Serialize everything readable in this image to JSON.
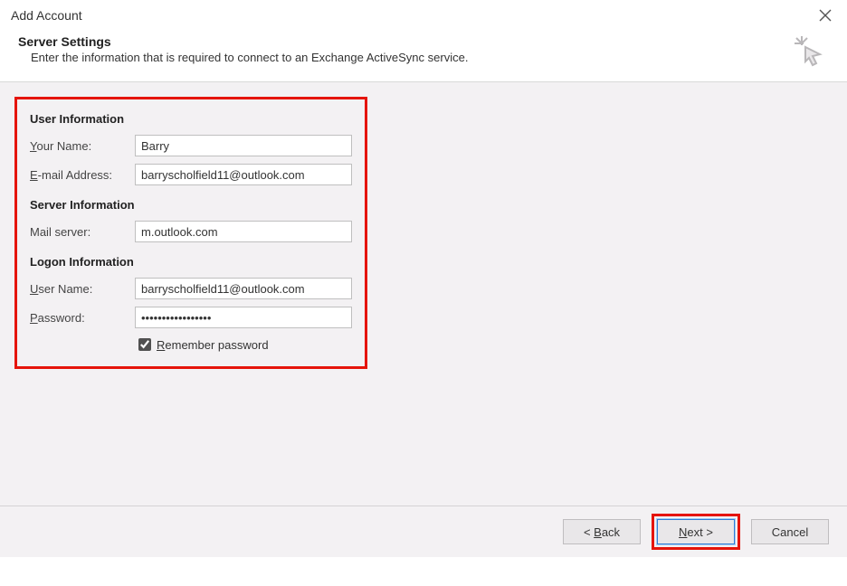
{
  "window": {
    "title": "Add Account"
  },
  "header": {
    "title": "Server Settings",
    "subtitle": "Enter the information that is required to connect to an Exchange ActiveSync service."
  },
  "sections": {
    "user_info_title": "User Information",
    "server_info_title": "Server Information",
    "logon_info_title": "Logon Information"
  },
  "labels": {
    "your_name_pre": "",
    "your_name_u": "Y",
    "your_name_post": "our Name:",
    "email_pre": "",
    "email_u": "E",
    "email_post": "-mail Address:",
    "mail_server": "Mail server:",
    "user_name_pre": "",
    "user_name_u": "U",
    "user_name_post": "ser Name:",
    "password_pre": "",
    "password_u": "P",
    "password_post": "assword:",
    "remember_pre": "",
    "remember_u": "R",
    "remember_post": "emember password"
  },
  "fields": {
    "your_name": "Barry",
    "email": "barryscholfield11@outlook.com",
    "mail_server": "m.outlook.com",
    "user_name": "barryscholfield11@outlook.com",
    "password": "•••••••••••••••••",
    "remember_checked": true
  },
  "buttons": {
    "back_pre": "< ",
    "back_u": "B",
    "back_post": "ack",
    "next_pre": "",
    "next_u": "N",
    "next_post": "ext >",
    "cancel": "Cancel"
  }
}
